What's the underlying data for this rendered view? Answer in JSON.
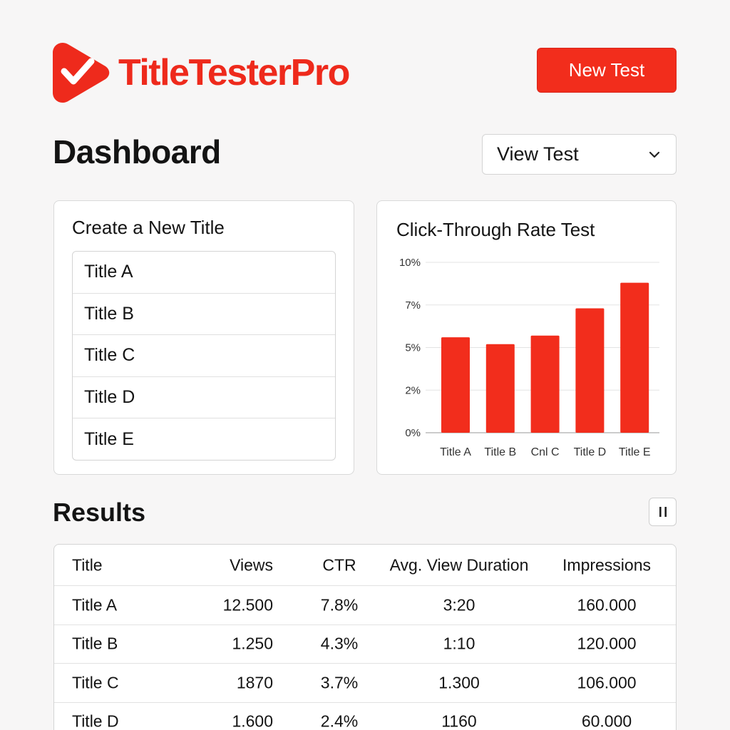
{
  "brand": {
    "name": "TitleTesterPro",
    "logo_icon": "play-check-icon",
    "color": "#ee2a1c"
  },
  "header": {
    "new_test_label": "New Test"
  },
  "page": {
    "title": "Dashboard"
  },
  "view_select": {
    "selected": "View Test",
    "icon": "chevron-down-icon"
  },
  "create_card": {
    "title": "Create a New Title",
    "items": [
      "Title A",
      "Title B",
      "Title C",
      "Title D",
      "Title E"
    ]
  },
  "chart_card": {
    "title": "Click-Through Rate Test"
  },
  "chart_data": {
    "type": "bar",
    "title": "Click-Through Rate Test",
    "categories": [
      "Title A",
      "Title B",
      "Cnl C",
      "Title D",
      "Title E"
    ],
    "values": [
      5.6,
      5.2,
      5.7,
      7.3,
      8.8
    ],
    "y_ticks": [
      "0%",
      "2%",
      "5%",
      "7%",
      "10%"
    ],
    "ylim": [
      0,
      10
    ],
    "grid": true,
    "bar_color": "#f22d1c"
  },
  "results": {
    "title": "Results",
    "pause_icon": "pause-icon",
    "columns": [
      "Title",
      "Views",
      "CTR",
      "Avg. View Duration",
      "Impressions"
    ],
    "rows": [
      [
        "Title A",
        "12.500",
        "7.8%",
        "3:20",
        "160.000"
      ],
      [
        "Title B",
        "1.250",
        "4.3%",
        "1:10",
        "120.000"
      ],
      [
        "Title C",
        "1870",
        "3.7%",
        "1.300",
        "106.000"
      ],
      [
        "Title D",
        "1.600",
        "2.4%",
        "1160",
        "60.000"
      ]
    ]
  }
}
